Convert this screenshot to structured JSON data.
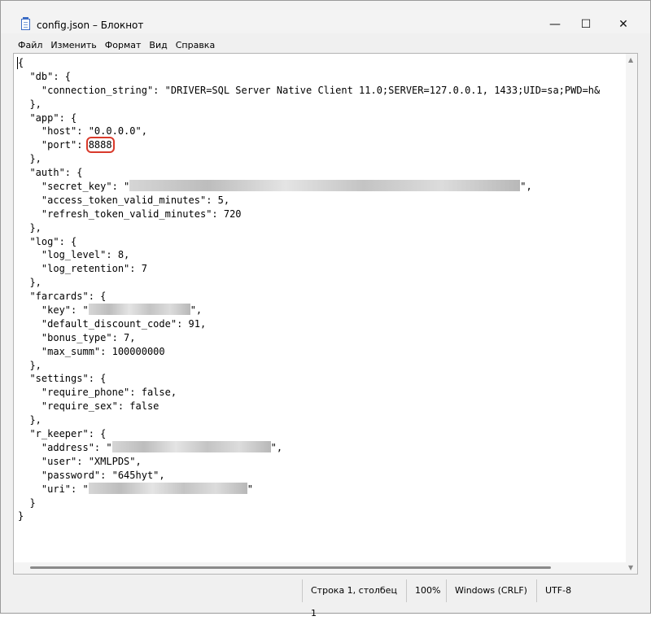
{
  "window": {
    "title": "config.json – Блокнот",
    "controls": {
      "minimize": "—",
      "maximize": "☐",
      "close": "✕"
    }
  },
  "menu": {
    "items": [
      "Файл",
      "Изменить",
      "Формат",
      "Вид",
      "Справка"
    ]
  },
  "editor": {
    "lines": [
      "{",
      "  \"db\": {",
      "    \"connection_string\": \"DRIVER=SQL Server Native Client 11.0;SERVER=127.0.0.1, 1433;UID=sa;PWD=h&",
      "  },",
      "  \"app\": {",
      "    \"host\": \"0.0.0.0\",",
      "    \"port\": 8888",
      "  },",
      "  \"auth\": {",
      "    \"secret_key\": \"[redacted]\",",
      "    \"access_token_valid_minutes\": 5,",
      "    \"refresh_token_valid_minutes\": 720",
      "  },",
      "  \"log\": {",
      "    \"log_level\": 8,",
      "    \"log_retention\": 7",
      "  },",
      "  \"farcards\": {",
      "    \"key\": \"[redacted]\",",
      "    \"default_discount_code\": 91,",
      "    \"bonus_type\": 7,",
      "    \"max_summ\": 100000000",
      "  },",
      "  \"settings\": {",
      "    \"require_phone\": false,",
      "    \"require_sex\": false",
      "  },",
      "  \"r_keeper\": {",
      "    \"address\": \"[redacted]\",",
      "    \"user\": \"XMLPDS\",",
      "    \"password\": \"645hyt\",",
      "    \"uri\": \"[redacted]\"",
      "  }",
      "}"
    ],
    "highlighted_value": "8888"
  },
  "statusbar": {
    "position": "Строка 1, столбец 1",
    "zoom": "100%",
    "line_endings": "Windows (CRLF)",
    "encoding": "UTF-8"
  },
  "colors": {
    "highlight_box": "#d93a2b",
    "redaction": "#c8c8c8"
  }
}
